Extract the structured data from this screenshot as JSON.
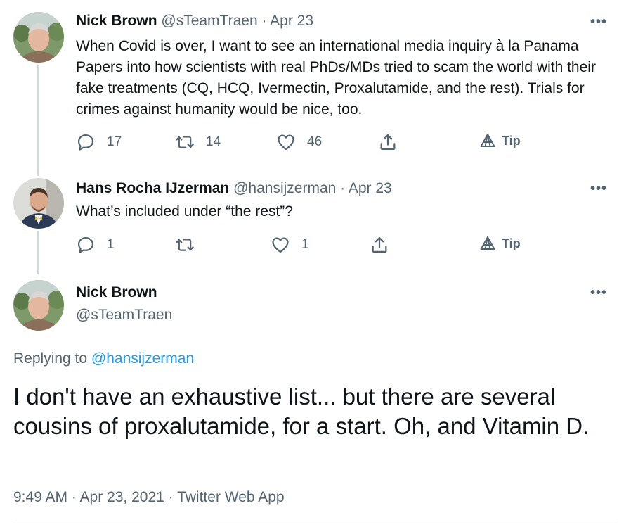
{
  "thread": [
    {
      "name": "Nick Brown",
      "handle": "@sTeamTraen",
      "sep": "·",
      "date": "Apr 23",
      "more": "•••",
      "text": "When Covid is over, I want to see an international media inquiry à la Panama Papers into how scientists with real PhDs/MDs tried to scam the world with their fake treatments (CQ, HCQ, Ivermectin, Proxalutamide, and the rest). Trials for crimes against humanity would be nice, too.",
      "replies": "17",
      "retweets": "14",
      "likes": "46",
      "tip": "Tip"
    },
    {
      "name": "Hans Rocha IJzerman",
      "handle": "@hansijzerman",
      "sep": "·",
      "date": "Apr 23",
      "more": "•••",
      "text": "What’s included under “the rest”?",
      "replies": "1",
      "retweets": "",
      "likes": "1",
      "tip": "Tip"
    }
  ],
  "main": {
    "name": "Nick Brown",
    "handle": "@sTeamTraen",
    "more": "•••",
    "replying_prefix": "Replying to",
    "replying_to": "@hansijzerman",
    "text": "I don't have an exhaustive list... but there are several cousins of proxalutamide, for a start. Oh, and Vitamin D.",
    "meta": "9:49 AM · Apr 23, 2021 · Twitter Web App"
  },
  "colors": {
    "text": "#0f1419",
    "secondary": "#536471",
    "link": "#1d9bf0",
    "thread_line": "#cfd9de"
  }
}
